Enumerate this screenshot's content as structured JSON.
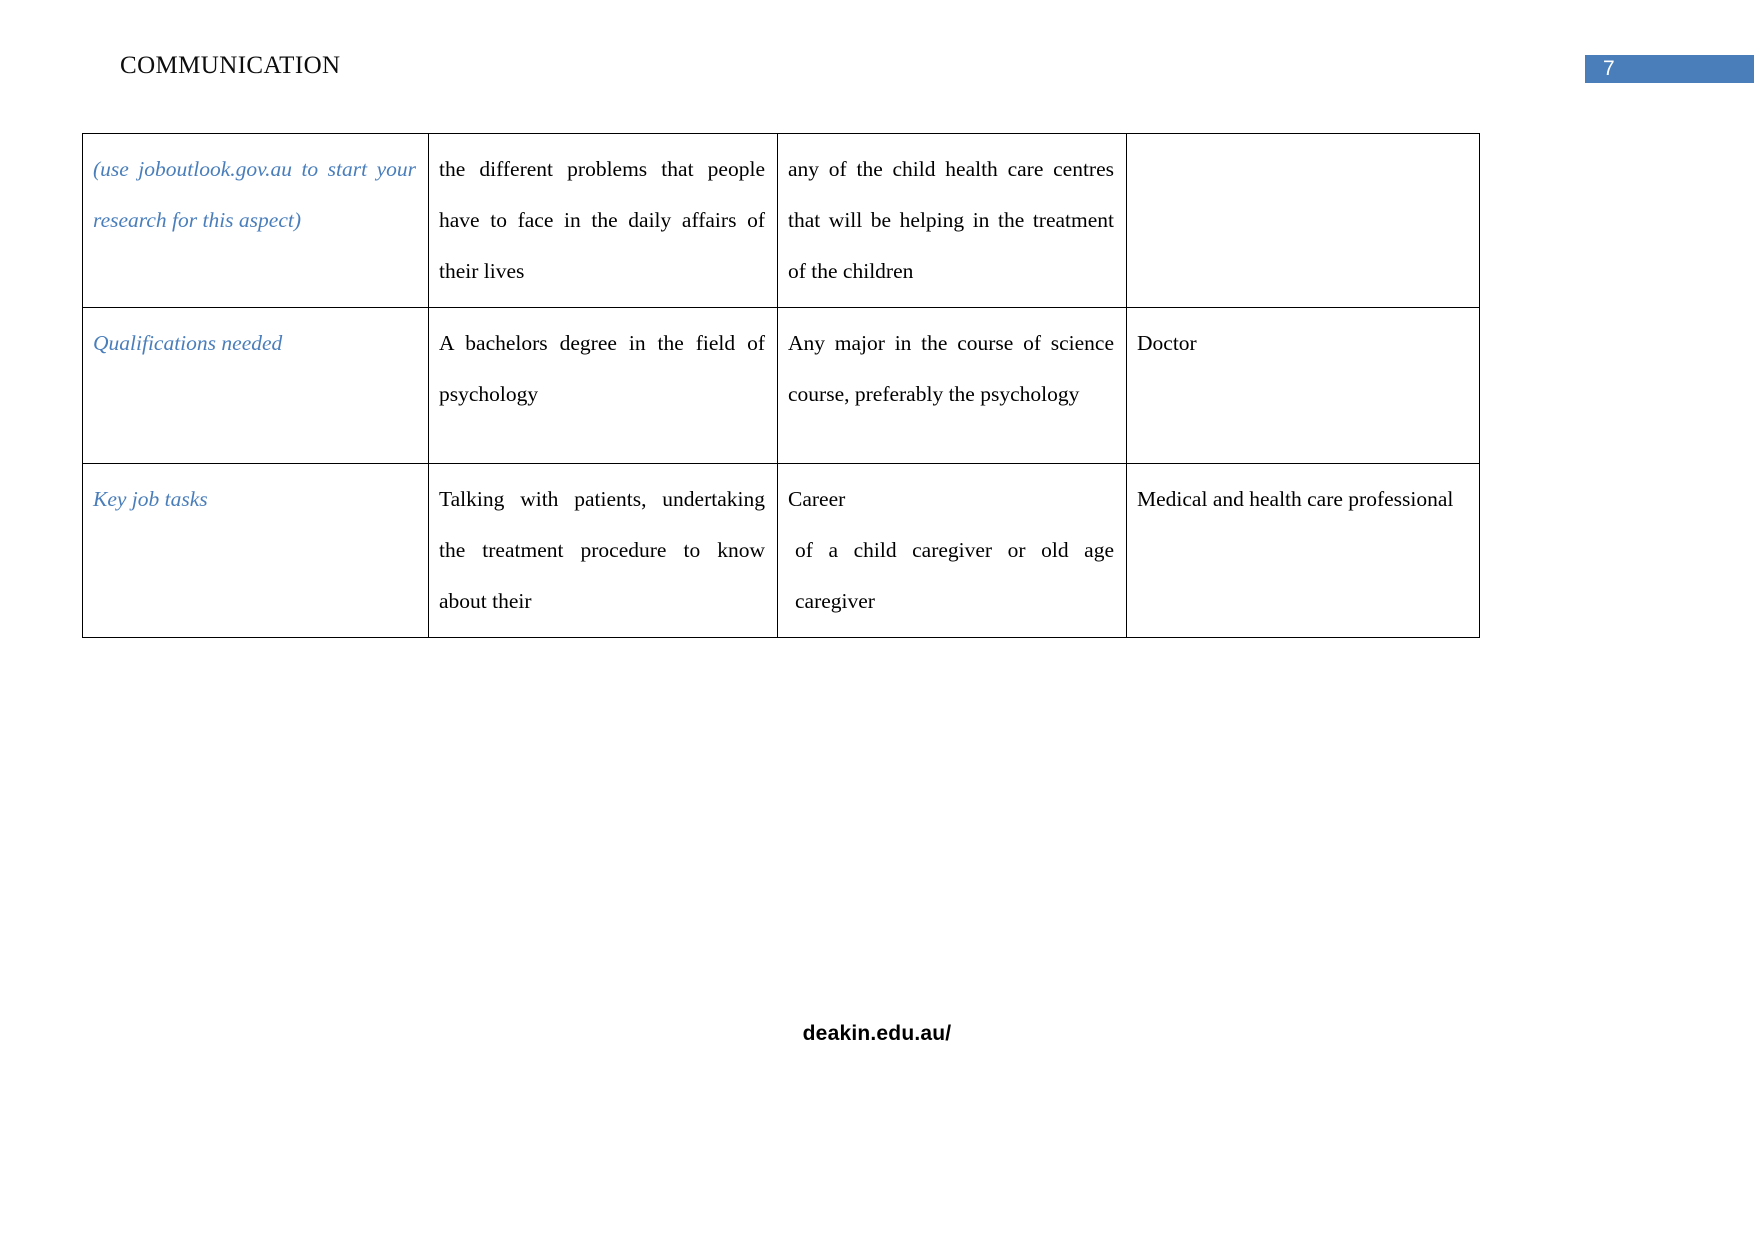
{
  "header": {
    "title": "COMMUNICATION",
    "page_number": "7",
    "badge_color": "#4a7ebb"
  },
  "footer": {
    "text": "deakin.edu.au/"
  },
  "table": {
    "label_color": "#4a7ebb",
    "rows": [
      {
        "label": "(use joboutlook.gov.au to start your research for this aspect)",
        "col_b": "the different problems that people have to face in the daily affairs of their lives",
        "col_c": "any of the child health care centres that will be helping in the treatment of the children",
        "col_d": ""
      },
      {
        "label": "Qualifications needed",
        "col_b": "A bachelors degree in the field of psychology",
        "col_c": "Any major in the course of science course, preferably the psychology",
        "col_d": "Doctor"
      },
      {
        "label": "Key job tasks",
        "col_b": "Talking with patients, undertaking the treatment procedure to know about their",
        "col_c_line1": "Career",
        "col_c_line2": "of a child caregiver or old age caregiver",
        "col_d": "Medical and health care professional"
      }
    ]
  }
}
